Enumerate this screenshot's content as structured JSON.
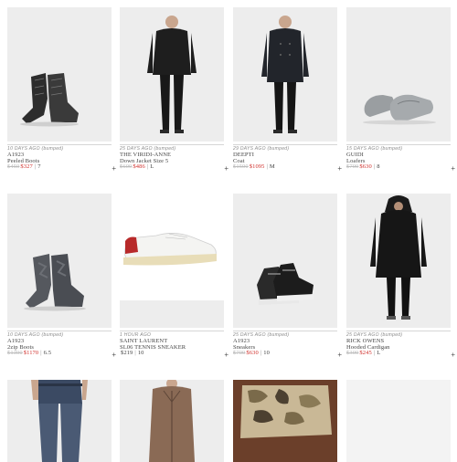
{
  "listings": [
    {
      "ago": "10 DAYS AGO",
      "bumped": "(bumped)",
      "brand": "A1923",
      "name": "Peeled Boots",
      "old_price": "$450",
      "price": "$327",
      "size": "7"
    },
    {
      "ago": "25 DAYS AGO",
      "bumped": "(bumped)",
      "brand": "THE VIRIDI-ANNE",
      "name": "Down Jacket Size 5",
      "old_price": "$600",
      "price": "$486",
      "size": "L"
    },
    {
      "ago": "29 DAYS AGO",
      "bumped": "(bumped)",
      "brand": "DEEPTI",
      "name": "Coat",
      "old_price": "$1500",
      "price": "$1095",
      "size": "M"
    },
    {
      "ago": "15 DAYS AGO",
      "bumped": "(bumped)",
      "brand": "GUIDI",
      "name": "Loafers",
      "old_price": "$700",
      "price": "$630",
      "size": "8"
    },
    {
      "ago": "10 DAYS AGO",
      "bumped": "(bumped)",
      "brand": "A1923",
      "name": "2zip Boots",
      "old_price": "$1300",
      "price": "$1170",
      "size": "6.5"
    },
    {
      "ago": "1 HOUR AGO",
      "bumped": "",
      "brand": "SAINT LAURENT",
      "name": "Sl06 Tennis Sneaker",
      "old_price": "",
      "price": "$219",
      "size": "10"
    },
    {
      "ago": "25 DAYS AGO",
      "bumped": "(bumped)",
      "brand": "A1923",
      "name": "Sneakers",
      "old_price": "$700",
      "price": "$630",
      "size": "10"
    },
    {
      "ago": "25 DAYS AGO",
      "bumped": "(bumped)",
      "brand": "RICK OWENS",
      "name": "Hooded Cardigan",
      "old_price": "$300",
      "price": "$245",
      "size": "L"
    }
  ],
  "plus_label": "+",
  "colors": {
    "sale_red": "#d0312d",
    "photo_bg": "#ededed",
    "old_price": "#bbbbbb"
  },
  "photos": [
    "boots-dark",
    "person-black-jacket",
    "person-peacoat",
    "gray-loafers",
    "boots-gray-camo",
    "white-sneaker-red-heel",
    "black-hightop-sneakers",
    "person-hooded-cardigan",
    "person-jeans",
    "person-leather-jacket",
    "camo-print-item",
    "blank-white"
  ]
}
